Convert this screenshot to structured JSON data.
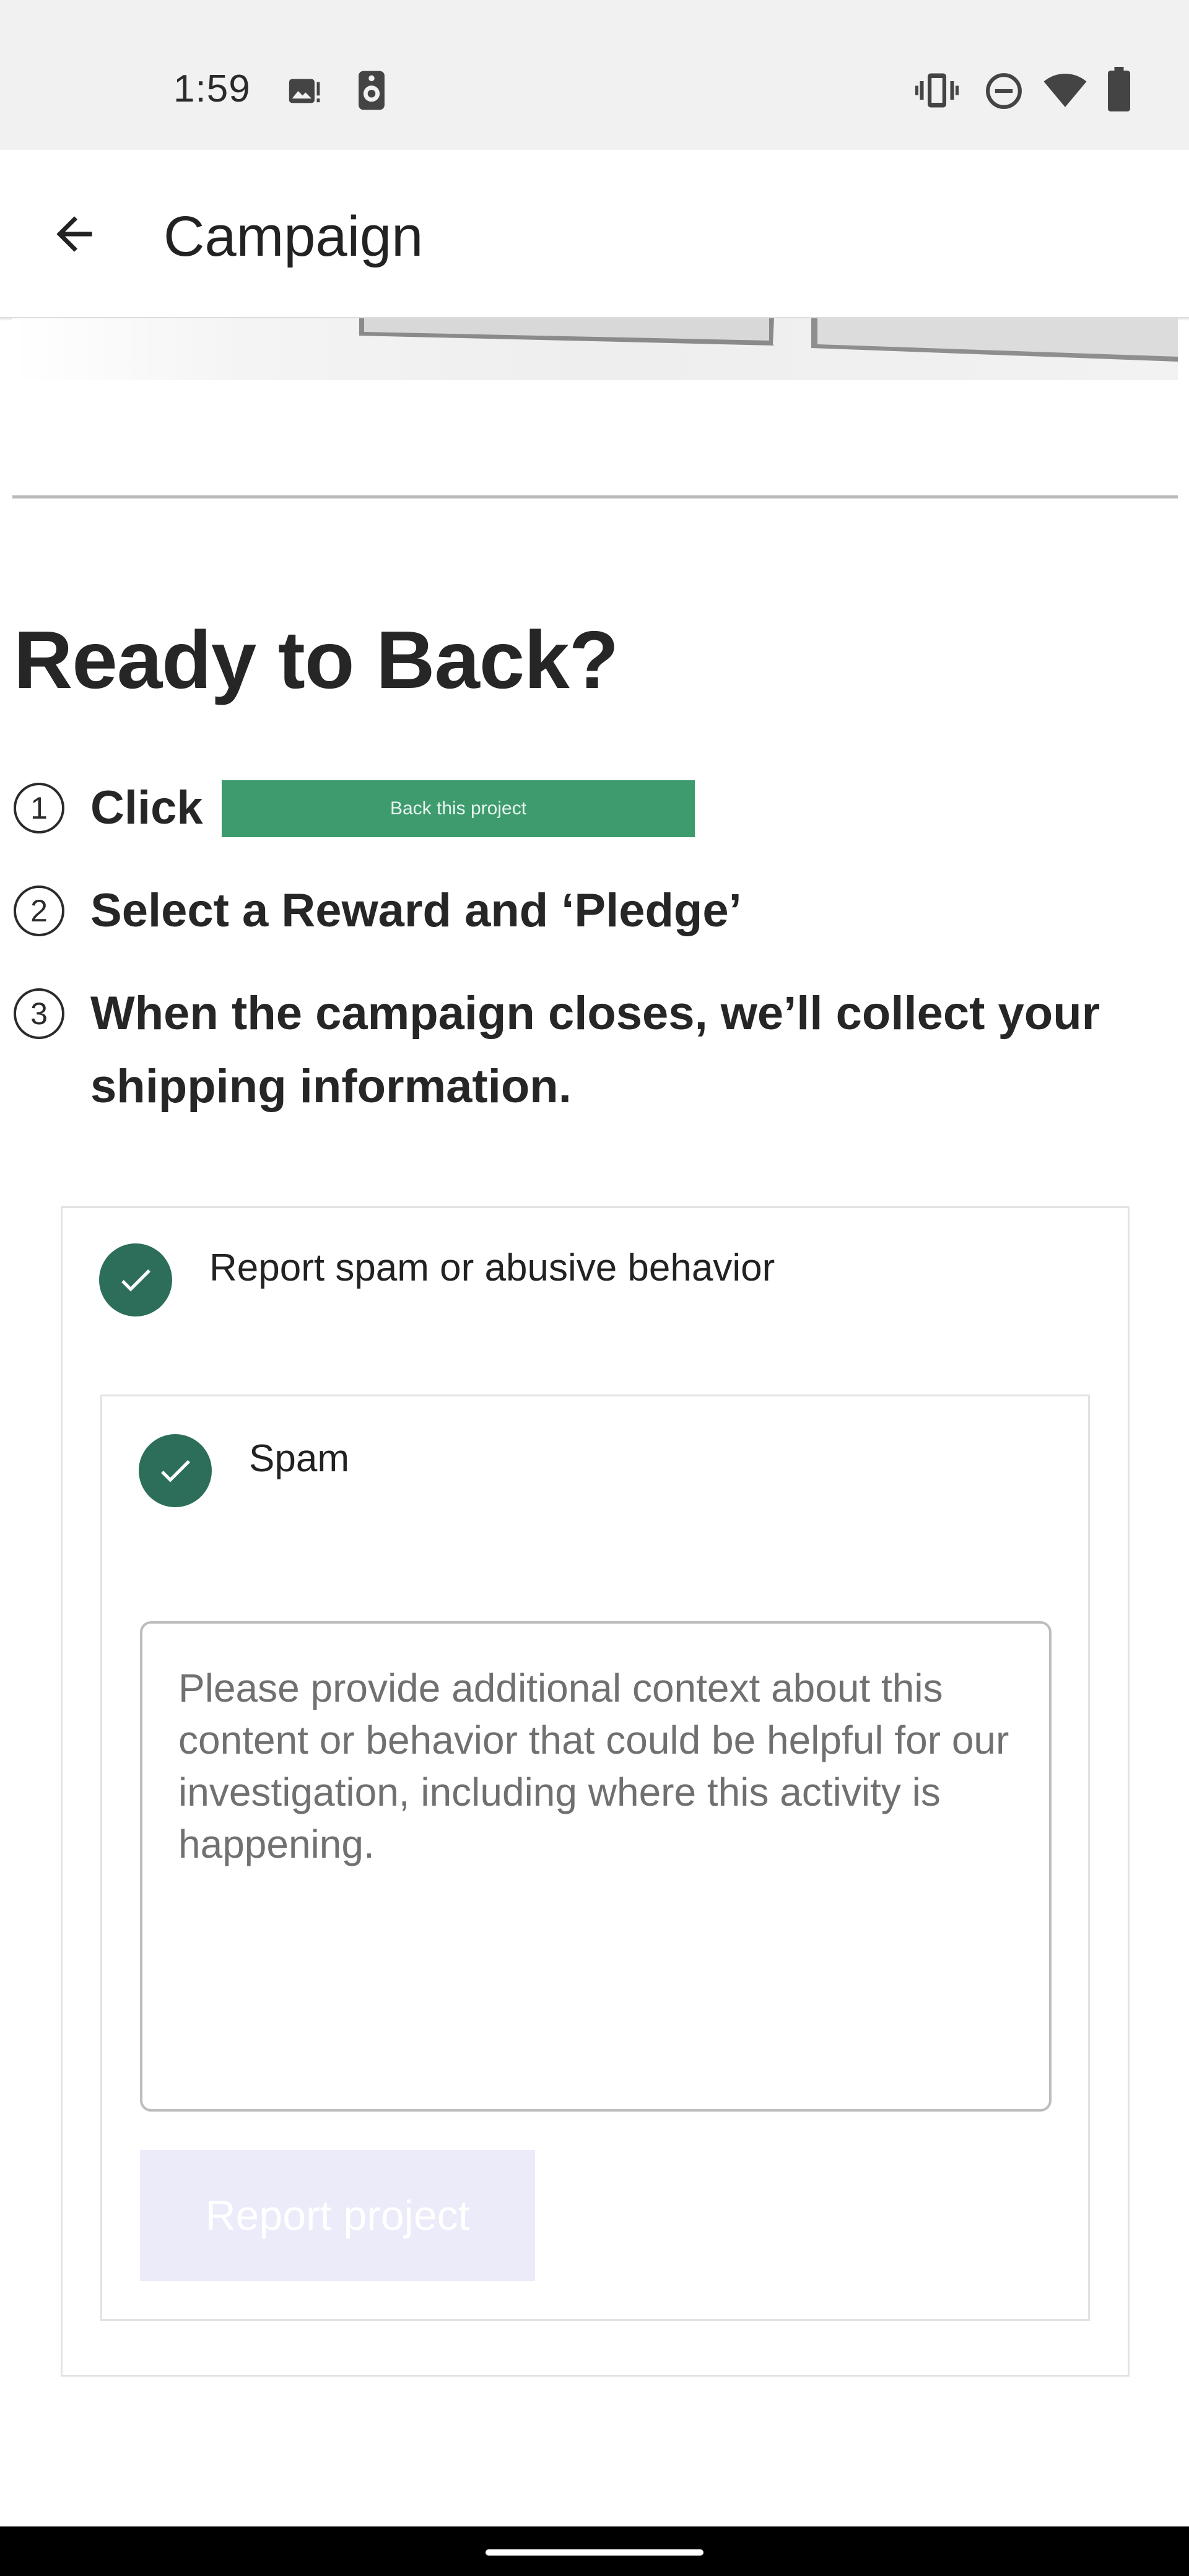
{
  "status_bar": {
    "time": "1:59",
    "icons": [
      "image-notification-icon",
      "speaker-notification-icon",
      "vibrate-icon",
      "do-not-disturb-icon",
      "wifi-icon",
      "battery-icon"
    ]
  },
  "app_bar": {
    "back_icon": "arrow-back-icon",
    "title": "Campaign"
  },
  "campaign_content": {
    "heading": "Ready to Back?",
    "steps": [
      {
        "number": "1",
        "text": "Click",
        "cta_label": "Back this project",
        "cta_color": "#3d9b6e"
      },
      {
        "number": "2",
        "text": "Select a Reward and ‘Pledge’"
      },
      {
        "number": "3",
        "text_line1": "When the campaign closes, we’ll collect your",
        "text_line2": "shipping information."
      }
    ]
  },
  "report": {
    "option_label": "Report spam or abusive behavior",
    "sub_option_label": "Spam",
    "check_color": "#2c6e5a",
    "textarea_placeholder": "Please provide additional context about this content or behavior that could be helpful for our investigation, including where this activity is happening.",
    "submit_label": "Report project",
    "submit_state": "disabled"
  }
}
